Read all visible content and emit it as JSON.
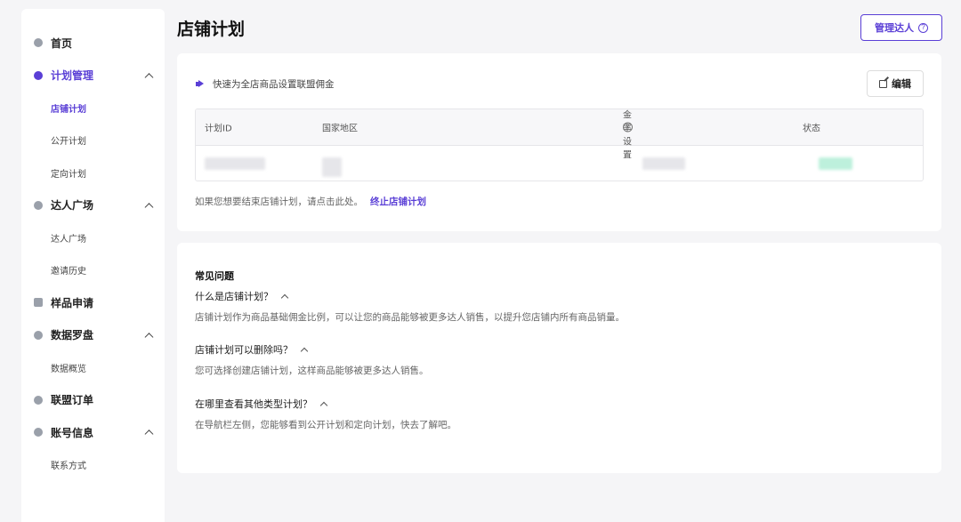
{
  "sidebar": {
    "home": "首页",
    "plan_mgmt": "计划管理",
    "store_plan": "店铺计划",
    "public_plan": "公开计划",
    "targeted_plan": "定向计划",
    "influencer_square": "达人广场",
    "influencer_square_sub": "达人广场",
    "invite_history": "邀请历史",
    "sample_request": "样品申请",
    "data_compass": "数据罗盘",
    "data_overview": "数据概览",
    "affiliate_orders": "联盟订单",
    "account_info": "账号信息",
    "contact": "联系方式"
  },
  "header": {
    "title": "店铺计划",
    "manage_btn": "管理达人"
  },
  "plan_card": {
    "notice": "快速为全店商品设置联盟佣金",
    "edit_btn": "编辑",
    "columns": {
      "plan_id": "计划ID",
      "region": "国家地区",
      "commission": "佣金率设置",
      "status": "状态"
    },
    "footer_text": "如果您想要结束店铺计划，请点击此处。",
    "footer_link": "终止店铺计划"
  },
  "faq": {
    "title": "常见问题",
    "q1": "什么是店铺计划？",
    "a1": "店铺计划作为商品基础佣金比例，可以让您的商品能够被更多达人销售，以提升您店铺内所有商品销量。",
    "q2": "店铺计划可以删除吗？",
    "a2": "您可选择创建店铺计划，这样商品能够被更多达人销售。",
    "q3": "在哪里查看其他类型计划？",
    "a3": "在导航栏左侧，您能够看到公开计划和定向计划，快去了解吧。"
  },
  "colors": {
    "accent": "#5a3fd6"
  }
}
